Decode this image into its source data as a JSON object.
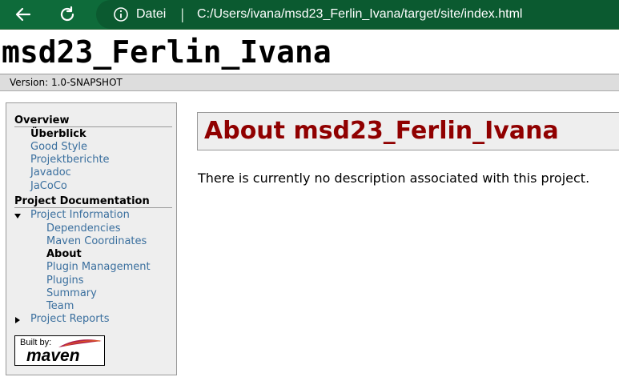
{
  "browser": {
    "back_icon": "arrow-left-icon",
    "reload_icon": "reload-icon",
    "info_icon": "info-icon",
    "scheme_label": "Datei",
    "url": "C:/Users/ivana/msd23_Ferlin_Ivana/target/site/index.html",
    "theme_color": "#0e6b3a"
  },
  "header": {
    "site_title": "msd23_Ferlin_Ivana",
    "version": "Version: 1.0-SNAPSHOT"
  },
  "sidebar": {
    "overview_heading": "Overview",
    "overview_items": [
      "Überblick",
      "Good Style",
      "Projektberichte",
      "Javadoc",
      "JaCoCo"
    ],
    "docs_heading": "Project Documentation",
    "project_information": "Project Information",
    "project_info_items": [
      "Dependencies",
      "Maven Coordinates",
      "About",
      "Plugin Management",
      "Plugins",
      "Summary",
      "Team"
    ],
    "project_reports": "Project Reports",
    "badge_built_by": "Built by:",
    "badge_maven": "maven",
    "link_color": "#3a6f9e"
  },
  "main": {
    "title": "About msd23_Ferlin_Ivana",
    "description": "There is currently no description associated with this project.",
    "title_color": "#900000"
  }
}
